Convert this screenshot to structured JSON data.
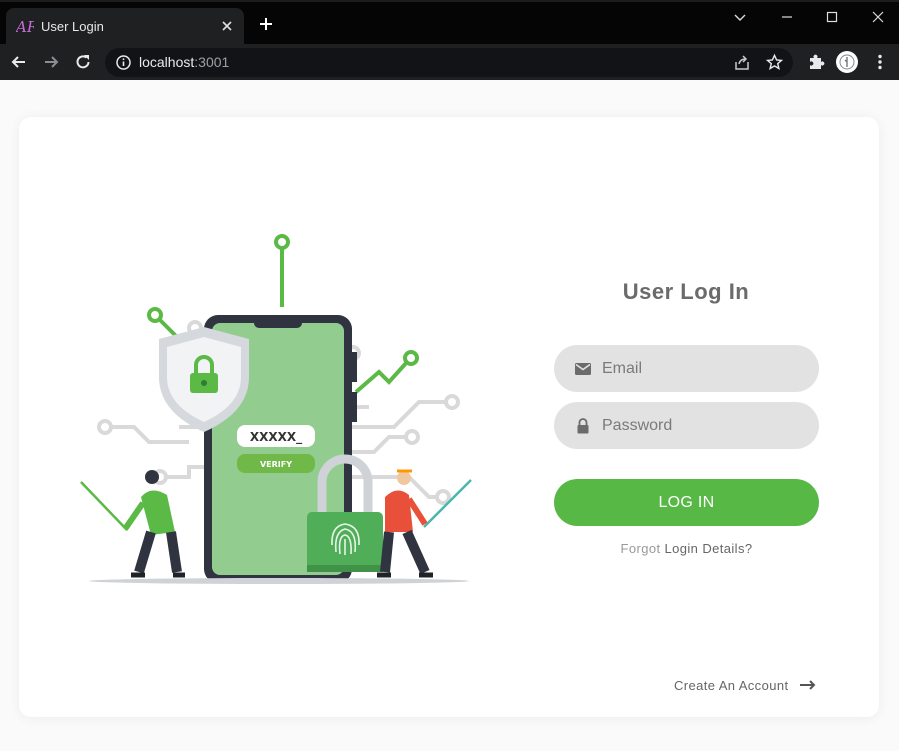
{
  "browser": {
    "tab_title": "User Login",
    "tab_close_icon": "close-icon",
    "new_tab_icon": "plus-icon",
    "url_host": "localhost",
    "url_port": ":3001"
  },
  "login": {
    "title": "User Log In",
    "email_placeholder": "Email",
    "password_placeholder": "Password",
    "login_button": "LOG IN",
    "forgot_prefix": "Forgot",
    "forgot_link": "Login Details?",
    "create_account": "Create An Account"
  },
  "illustration": {
    "otp_text": "XXXXX_",
    "verify_label": "VERIFY"
  },
  "colors": {
    "accent_green": "#57b846",
    "field_bg": "#e2e2e2",
    "title_text": "#6b6b6b"
  }
}
